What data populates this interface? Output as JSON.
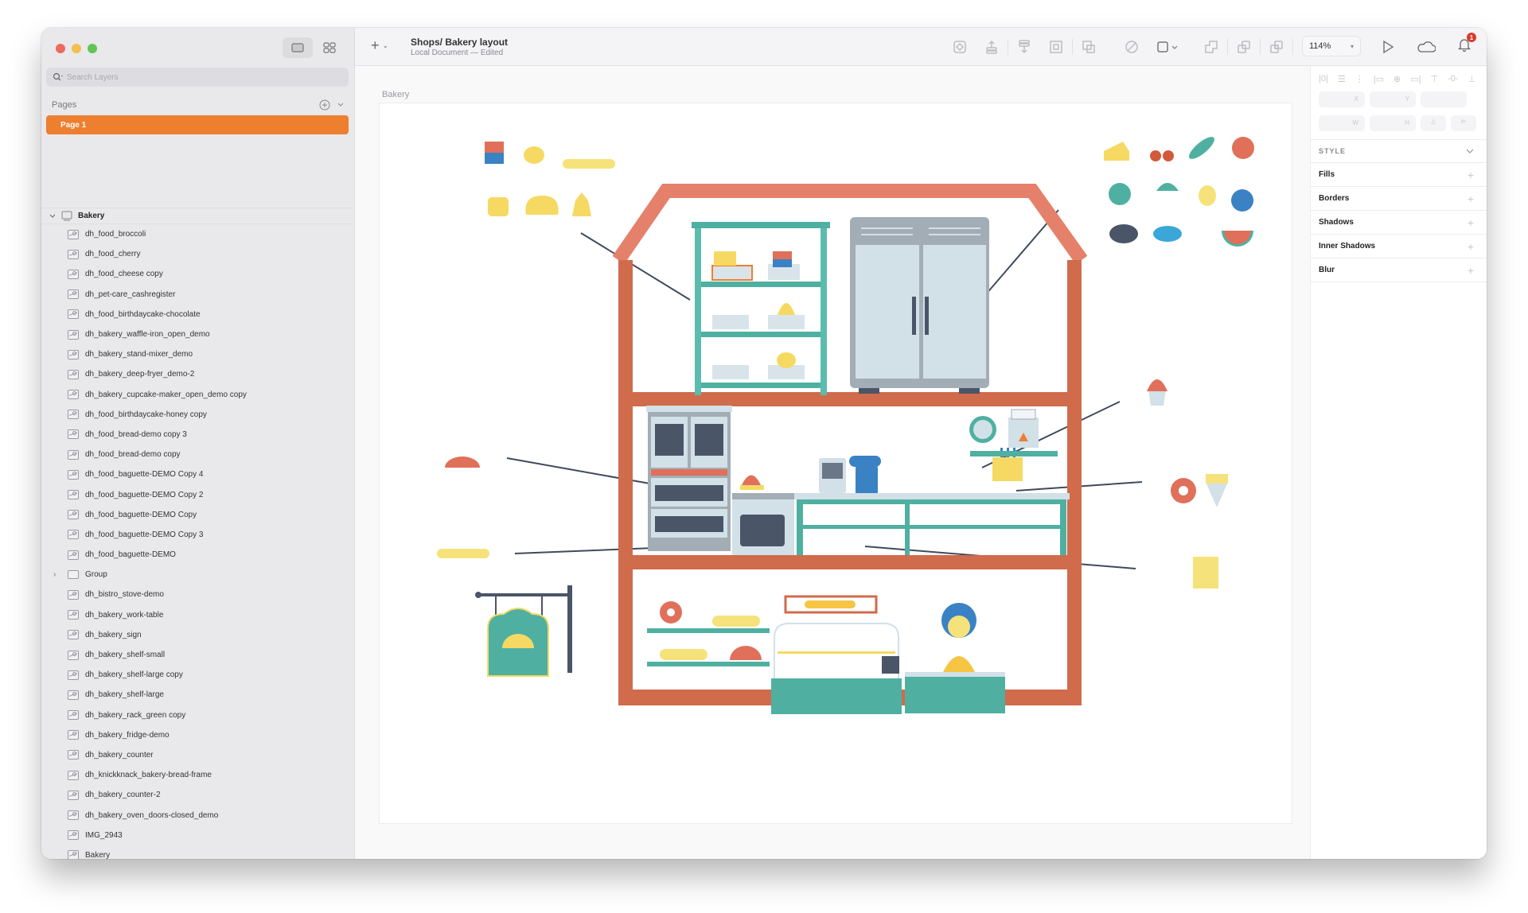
{
  "window": {
    "title": "Shops/ Bakery layout",
    "subtitle": "Local Document — Edited"
  },
  "sidebar": {
    "search_placeholder": "Search Layers",
    "pages_label": "Pages",
    "pages": [
      {
        "label": "Page 1",
        "selected": true
      }
    ],
    "root_layer": "Bakery",
    "layers": [
      {
        "name": "dh_food_broccoli",
        "type": "image"
      },
      {
        "name": "dh_food_cherry",
        "type": "image"
      },
      {
        "name": "dh_food_cheese copy",
        "type": "image"
      },
      {
        "name": "dh_pet-care_cashregister",
        "type": "image"
      },
      {
        "name": "dh_food_birthdaycake-chocolate",
        "type": "image"
      },
      {
        "name": "dh_bakery_waffle-iron_open_demo",
        "type": "image"
      },
      {
        "name": "dh_bakery_stand-mixer_demo",
        "type": "image"
      },
      {
        "name": "dh_bakery_deep-fryer_demo-2",
        "type": "image"
      },
      {
        "name": "dh_bakery_cupcake-maker_open_demo copy",
        "type": "image"
      },
      {
        "name": "dh_food_birthdaycake-honey copy",
        "type": "image"
      },
      {
        "name": "dh_food_bread-demo copy 3",
        "type": "image"
      },
      {
        "name": "dh_food_bread-demo copy",
        "type": "image"
      },
      {
        "name": "dh_food_baguette-DEMO Copy 4",
        "type": "image"
      },
      {
        "name": "dh_food_baguette-DEMO Copy 2",
        "type": "image"
      },
      {
        "name": "dh_food_baguette-DEMO Copy",
        "type": "image"
      },
      {
        "name": "dh_food_baguette-DEMO Copy 3",
        "type": "image"
      },
      {
        "name": "dh_food_baguette-DEMO",
        "type": "image"
      },
      {
        "name": "Group",
        "type": "group"
      },
      {
        "name": "dh_bistro_stove-demo",
        "type": "image"
      },
      {
        "name": "dh_bakery_work-table",
        "type": "image"
      },
      {
        "name": "dh_bakery_sign",
        "type": "image"
      },
      {
        "name": "dh_bakery_shelf-small",
        "type": "image"
      },
      {
        "name": "dh_bakery_shelf-large copy",
        "type": "image"
      },
      {
        "name": "dh_bakery_shelf-large",
        "type": "image"
      },
      {
        "name": "dh_bakery_rack_green copy",
        "type": "image"
      },
      {
        "name": "dh_bakery_fridge-demo",
        "type": "image"
      },
      {
        "name": "dh_bakery_counter",
        "type": "image"
      },
      {
        "name": "dh_knickknack_bakery-bread-frame",
        "type": "image"
      },
      {
        "name": "dh_bakery_counter-2",
        "type": "image"
      },
      {
        "name": "dh_bakery_oven_doors-closed_demo",
        "type": "image"
      },
      {
        "name": "IMG_2943",
        "type": "image"
      },
      {
        "name": "Bakery",
        "type": "image"
      }
    ]
  },
  "toolbar": {
    "tools": [
      "create-symbol",
      "forward",
      "backward",
      "mask",
      "scale",
      "boolean-disabled",
      "resize",
      "union",
      "subtract",
      "intersect",
      "difference"
    ],
    "zoom": "114%",
    "notifications_count": "1"
  },
  "canvas": {
    "artboard_label": "Bakery"
  },
  "inspector": {
    "fields": {
      "x": "X",
      "y": "Y",
      "w": "W",
      "h": "H"
    },
    "style_label": "STYLE",
    "sections": [
      "Fills",
      "Borders",
      "Shadows",
      "Inner Shadows",
      "Blur"
    ]
  },
  "colors": {
    "accent": "#ed7f2f",
    "house_wall": "#d06b4c",
    "house_roof": "#e5806a",
    "teal": "#4fb0a2",
    "appliance_gray": "#a3adb6",
    "appliance_light": "#d2e0e8",
    "dark_slate": "#4b5568",
    "bread_yellow": "#f6e27a"
  }
}
